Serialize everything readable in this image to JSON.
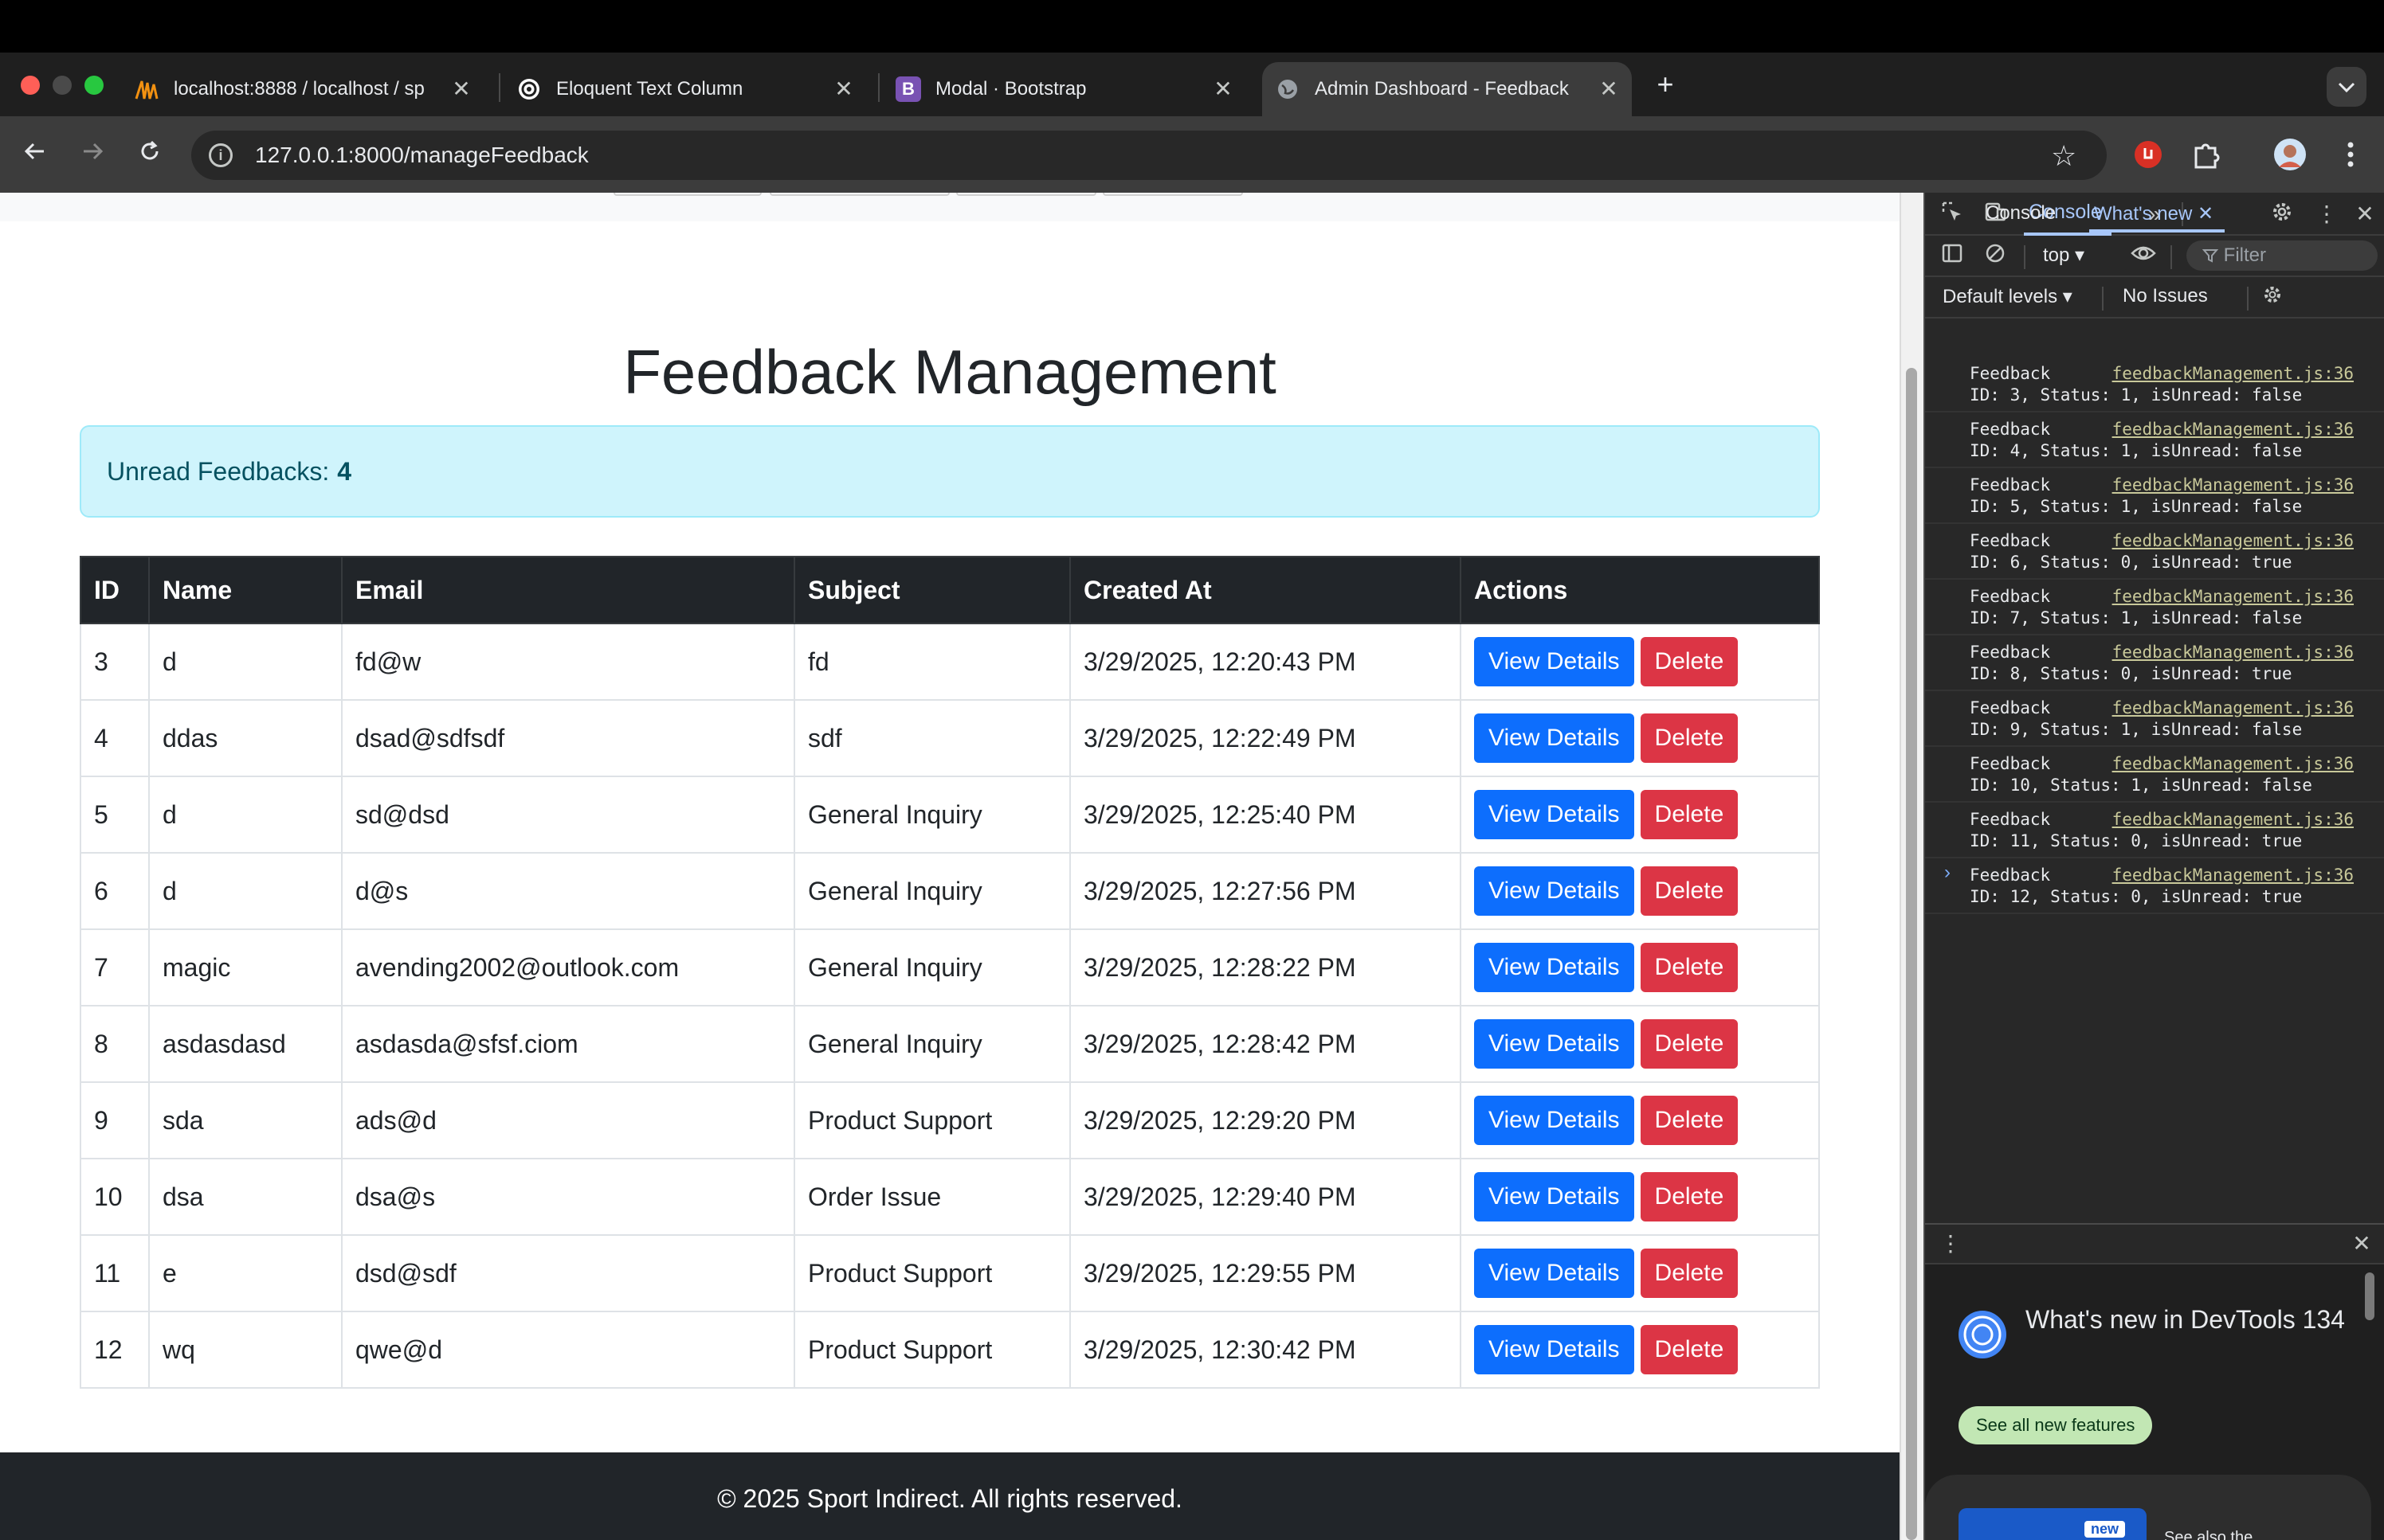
{
  "browser": {
    "tabs": [
      {
        "title": "localhost:8888 / localhost / sp",
        "icon": "phpmyadmin-icon"
      },
      {
        "title": "Eloquent Text Column",
        "icon": "openai-icon"
      },
      {
        "title": "Modal · Bootstrap",
        "icon": "bootstrap-icon",
        "glyph": "B"
      },
      {
        "title": "Admin Dashboard - Feedback",
        "icon": "globe-icon",
        "active": true
      }
    ],
    "close_glyph": "✕",
    "new_tab_glyph": "+",
    "url": "127.0.0.1:8000/manageFeedback"
  },
  "page": {
    "title": "Feedback Management",
    "unread_label": "Unread Feedbacks:",
    "unread_count": "4",
    "table": {
      "headers": [
        "ID",
        "Name",
        "Email",
        "Subject",
        "Created At",
        "Actions"
      ],
      "view_label": "View Details",
      "delete_label": "Delete",
      "rows": [
        {
          "id": "3",
          "name": "d",
          "email": "fd@w",
          "subject": "fd",
          "created": "3/29/2025, 12:20:43 PM"
        },
        {
          "id": "4",
          "name": "ddas",
          "email": "dsad@sdfsdf",
          "subject": "sdf",
          "created": "3/29/2025, 12:22:49 PM"
        },
        {
          "id": "5",
          "name": "d",
          "email": "sd@dsd",
          "subject": "General Inquiry",
          "created": "3/29/2025, 12:25:40 PM"
        },
        {
          "id": "6",
          "name": "d",
          "email": "d@s",
          "subject": "General Inquiry",
          "created": "3/29/2025, 12:27:56 PM"
        },
        {
          "id": "7",
          "name": "magic",
          "email": "avending2002@outlook.com",
          "subject": "General Inquiry",
          "created": "3/29/2025, 12:28:22 PM"
        },
        {
          "id": "8",
          "name": "asdasdasd",
          "email": "asdasda@sfsf.ciom",
          "subject": "General Inquiry",
          "created": "3/29/2025, 12:28:42 PM"
        },
        {
          "id": "9",
          "name": "sda",
          "email": "ads@d",
          "subject": "Product Support",
          "created": "3/29/2025, 12:29:20 PM"
        },
        {
          "id": "10",
          "name": "dsa",
          "email": "dsa@s",
          "subject": "Order Issue",
          "created": "3/29/2025, 12:29:40 PM"
        },
        {
          "id": "11",
          "name": "e",
          "email": "dsd@sdf",
          "subject": "Product Support",
          "created": "3/29/2025, 12:29:55 PM"
        },
        {
          "id": "12",
          "name": "wq",
          "email": "qwe@d",
          "subject": "Product Support",
          "created": "3/29/2025, 12:30:42 PM"
        }
      ]
    },
    "footer": "© 2025 Sport Indirect. All rights reserved."
  },
  "devtools": {
    "console_tab": "Console",
    "context": "top ▾",
    "filter_placeholder": "Filter",
    "levels": "Default levels ▾",
    "issues": "No Issues",
    "log_source": "feedbackManagement.js:36",
    "logs": [
      {
        "label": "Feedback",
        "detail": "ID: 3, Status: 1, isUnread: false"
      },
      {
        "label": "Feedback",
        "detail": "ID: 4, Status: 1, isUnread: false"
      },
      {
        "label": "Feedback",
        "detail": "ID: 5, Status: 1, isUnread: false"
      },
      {
        "label": "Feedback",
        "detail": "ID: 6, Status: 0, isUnread: true"
      },
      {
        "label": "Feedback",
        "detail": "ID: 7, Status: 1, isUnread: false"
      },
      {
        "label": "Feedback",
        "detail": "ID: 8, Status: 0, isUnread: true"
      },
      {
        "label": "Feedback",
        "detail": "ID: 9, Status: 1, isUnread: false"
      },
      {
        "label": "Feedback",
        "detail": "ID: 10, Status: 1, isUnread: false"
      },
      {
        "label": "Feedback",
        "detail": "ID: 11, Status: 0, isUnread: true"
      },
      {
        "label": "Feedback",
        "detail": "ID: 12, Status: 0, isUnread: true"
      }
    ],
    "prompt": "›",
    "drawer": {
      "console_tab": "Console",
      "whatsnew_tab": "What's new ✕",
      "title": "What's new in DevTools 134",
      "button": "See all new features",
      "card_text": "See also the",
      "card_badge": "new"
    }
  }
}
